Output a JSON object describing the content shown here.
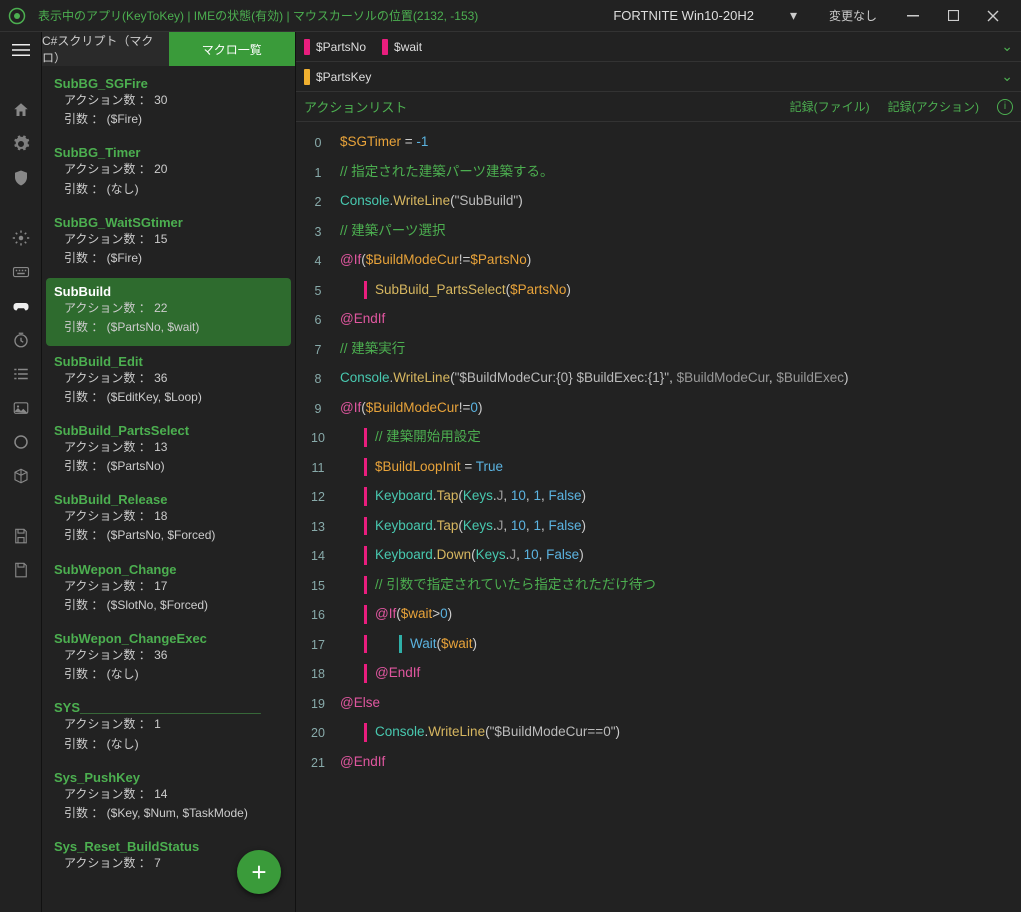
{
  "titlebar": {
    "info": "表示中のアプリ(KeyToKey)  |  IMEの状態(有効)  |  マウスカーソルの位置(2132, -153)",
    "center": "FORTNITE Win10-20H2",
    "status": "変更なし"
  },
  "sidebar": {
    "tabs": {
      "inactive": "C#スクリプト（マクロ）",
      "active": "マクロ一覧"
    },
    "action_label": "アクション数  ：",
    "args_label": "引数  ：",
    "items": [
      {
        "name": "SubBG_SGFire",
        "actions": "30",
        "args": "($Fire)",
        "selected": false
      },
      {
        "name": "SubBG_Timer",
        "actions": "20",
        "args": "(なし)",
        "selected": false
      },
      {
        "name": "SubBG_WaitSGtimer",
        "actions": "15",
        "args": "($Fire)",
        "selected": false
      },
      {
        "name": "SubBuild",
        "actions": "22",
        "args": "($PartsNo, $wait)",
        "selected": true
      },
      {
        "name": "SubBuild_Edit",
        "actions": "36",
        "args": "($EditKey, $Loop)",
        "selected": false
      },
      {
        "name": "SubBuild_PartsSelect",
        "actions": "13",
        "args": "($PartsNo)",
        "selected": false
      },
      {
        "name": "SubBuild_Release",
        "actions": "18",
        "args": "($PartsNo, $Forced)",
        "selected": false
      },
      {
        "name": "SubWepon_Change",
        "actions": "17",
        "args": "($SlotNo, $Forced)",
        "selected": false
      },
      {
        "name": "SubWepon_ChangeExec",
        "actions": "36",
        "args": "(なし)",
        "selected": false
      },
      {
        "name": "SYS_________________________",
        "actions": "1",
        "args": "(なし)",
        "selected": false
      },
      {
        "name": "Sys_PushKey",
        "actions": "14",
        "args": "($Key, $Num, $TaskMode)",
        "selected": false
      },
      {
        "name": "Sys_Reset_BuildStatus",
        "actions": "7",
        "args": "",
        "selected": false
      }
    ]
  },
  "main": {
    "tags": [
      {
        "label": "$PartsNo",
        "color": "pink"
      },
      {
        "label": "$wait",
        "color": "pink"
      },
      {
        "label": "$PartsKey",
        "color": "orange"
      }
    ],
    "header": {
      "title": "アクションリスト",
      "rec_file": "記録(ファイル)",
      "rec_action": "記録(アクション)"
    }
  },
  "code": [
    {
      "n": "0",
      "indent": 0,
      "bars": [],
      "tokens": [
        [
          "var",
          "$SGTimer"
        ],
        [
          "op",
          " = "
        ],
        [
          "num",
          "-1"
        ]
      ]
    },
    {
      "n": "1",
      "indent": 0,
      "bars": [],
      "tokens": [
        [
          "comment",
          "// 指定された建築パーツ建築する。"
        ]
      ]
    },
    {
      "n": "2",
      "indent": 0,
      "bars": [],
      "tokens": [
        [
          "type",
          "Console"
        ],
        [
          "op",
          "."
        ],
        [
          "fn",
          "WriteLine"
        ],
        [
          "paren",
          "("
        ],
        [
          "str",
          "\"SubBuild\""
        ],
        [
          "paren",
          ")"
        ]
      ]
    },
    {
      "n": "3",
      "indent": 0,
      "bars": [],
      "tokens": [
        [
          "comment",
          "// 建築パーツ選択"
        ]
      ]
    },
    {
      "n": "4",
      "indent": 0,
      "bars": [],
      "tokens": [
        [
          "kw",
          "@If"
        ],
        [
          "paren",
          "("
        ],
        [
          "var",
          "$BuildModeCur"
        ],
        [
          "op",
          "!="
        ],
        [
          "var",
          "$PartsNo"
        ],
        [
          "paren",
          ")"
        ]
      ]
    },
    {
      "n": "5",
      "indent": 1,
      "bars": [
        "pink"
      ],
      "tokens": [
        [
          "fn",
          "SubBuild_PartsSelect"
        ],
        [
          "paren",
          "("
        ],
        [
          "var",
          "$PartsNo"
        ],
        [
          "paren",
          ")"
        ]
      ]
    },
    {
      "n": "6",
      "indent": 0,
      "bars": [],
      "tokens": [
        [
          "kw",
          "@EndIf"
        ]
      ]
    },
    {
      "n": "7",
      "indent": 0,
      "bars": [],
      "tokens": [
        [
          "comment",
          "// 建築実行"
        ]
      ]
    },
    {
      "n": "8",
      "indent": 0,
      "bars": [],
      "tokens": [
        [
          "type",
          "Console"
        ],
        [
          "op",
          "."
        ],
        [
          "fn",
          "WriteLine"
        ],
        [
          "paren",
          "("
        ],
        [
          "str",
          "\"$BuildModeCur:{0} $BuildExec:{1}\""
        ],
        [
          "op",
          ", "
        ],
        [
          "key",
          "$BuildModeCur"
        ],
        [
          "op",
          ", "
        ],
        [
          "key",
          "$BuildExec"
        ],
        [
          "paren",
          ")"
        ]
      ]
    },
    {
      "n": "9",
      "indent": 0,
      "bars": [],
      "tokens": [
        [
          "kw",
          "@If"
        ],
        [
          "paren",
          "("
        ],
        [
          "var",
          "$BuildModeCur"
        ],
        [
          "op",
          "!="
        ],
        [
          "num",
          "0"
        ],
        [
          "paren",
          ")"
        ]
      ]
    },
    {
      "n": "10",
      "indent": 1,
      "bars": [
        "pink"
      ],
      "tokens": [
        [
          "comment",
          "// 建築開始用設定"
        ]
      ]
    },
    {
      "n": "11",
      "indent": 1,
      "bars": [
        "pink"
      ],
      "tokens": [
        [
          "var",
          "$BuildLoopInit"
        ],
        [
          "op",
          " = "
        ],
        [
          "blue",
          "True"
        ]
      ]
    },
    {
      "n": "12",
      "indent": 1,
      "bars": [
        "pink"
      ],
      "tokens": [
        [
          "type",
          "Keyboard"
        ],
        [
          "op",
          "."
        ],
        [
          "fn",
          "Tap"
        ],
        [
          "paren",
          "("
        ],
        [
          "type",
          "Keys"
        ],
        [
          "op",
          "."
        ],
        [
          "key",
          "J"
        ],
        [
          "op",
          ", "
        ],
        [
          "num",
          "10"
        ],
        [
          "op",
          ", "
        ],
        [
          "num",
          "1"
        ],
        [
          "op",
          ", "
        ],
        [
          "blue",
          "False"
        ],
        [
          "paren",
          ")"
        ]
      ]
    },
    {
      "n": "13",
      "indent": 1,
      "bars": [
        "pink"
      ],
      "tokens": [
        [
          "type",
          "Keyboard"
        ],
        [
          "op",
          "."
        ],
        [
          "fn",
          "Tap"
        ],
        [
          "paren",
          "("
        ],
        [
          "type",
          "Keys"
        ],
        [
          "op",
          "."
        ],
        [
          "key",
          "J"
        ],
        [
          "op",
          ", "
        ],
        [
          "num",
          "10"
        ],
        [
          "op",
          ", "
        ],
        [
          "num",
          "1"
        ],
        [
          "op",
          ", "
        ],
        [
          "blue",
          "False"
        ],
        [
          "paren",
          ")"
        ]
      ]
    },
    {
      "n": "14",
      "indent": 1,
      "bars": [
        "pink"
      ],
      "tokens": [
        [
          "type",
          "Keyboard"
        ],
        [
          "op",
          "."
        ],
        [
          "fn",
          "Down"
        ],
        [
          "paren",
          "("
        ],
        [
          "type",
          "Keys"
        ],
        [
          "op",
          "."
        ],
        [
          "key",
          "J"
        ],
        [
          "op",
          ", "
        ],
        [
          "num",
          "10"
        ],
        [
          "op",
          ", "
        ],
        [
          "blue",
          "False"
        ],
        [
          "paren",
          ")"
        ]
      ]
    },
    {
      "n": "15",
      "indent": 1,
      "bars": [
        "pink"
      ],
      "tokens": [
        [
          "comment",
          "// 引数で指定されていたら指定されただけ待つ"
        ]
      ]
    },
    {
      "n": "16",
      "indent": 1,
      "bars": [
        "pink"
      ],
      "tokens": [
        [
          "kw",
          "@If"
        ],
        [
          "paren",
          "("
        ],
        [
          "var",
          "$wait"
        ],
        [
          "op",
          ">"
        ],
        [
          "num",
          "0"
        ],
        [
          "paren",
          ")"
        ]
      ]
    },
    {
      "n": "17",
      "indent": 2,
      "bars": [
        "pink",
        "teal"
      ],
      "tokens": [
        [
          "blue",
          "Wait"
        ],
        [
          "paren",
          "("
        ],
        [
          "var",
          "$wait"
        ],
        [
          "paren",
          ")"
        ]
      ]
    },
    {
      "n": "18",
      "indent": 1,
      "bars": [
        "pink"
      ],
      "tokens": [
        [
          "kw",
          "@EndIf"
        ]
      ]
    },
    {
      "n": "19",
      "indent": 0,
      "bars": [],
      "tokens": [
        [
          "kw",
          "@Else"
        ]
      ]
    },
    {
      "n": "20",
      "indent": 1,
      "bars": [
        "pink"
      ],
      "tokens": [
        [
          "type",
          "Console"
        ],
        [
          "op",
          "."
        ],
        [
          "fn",
          "WriteLine"
        ],
        [
          "paren",
          "("
        ],
        [
          "str",
          "\"$BuildModeCur==0\""
        ],
        [
          "paren",
          ")"
        ]
      ]
    },
    {
      "n": "21",
      "indent": 0,
      "bars": [],
      "tokens": [
        [
          "kw",
          "@EndIf"
        ]
      ]
    }
  ]
}
